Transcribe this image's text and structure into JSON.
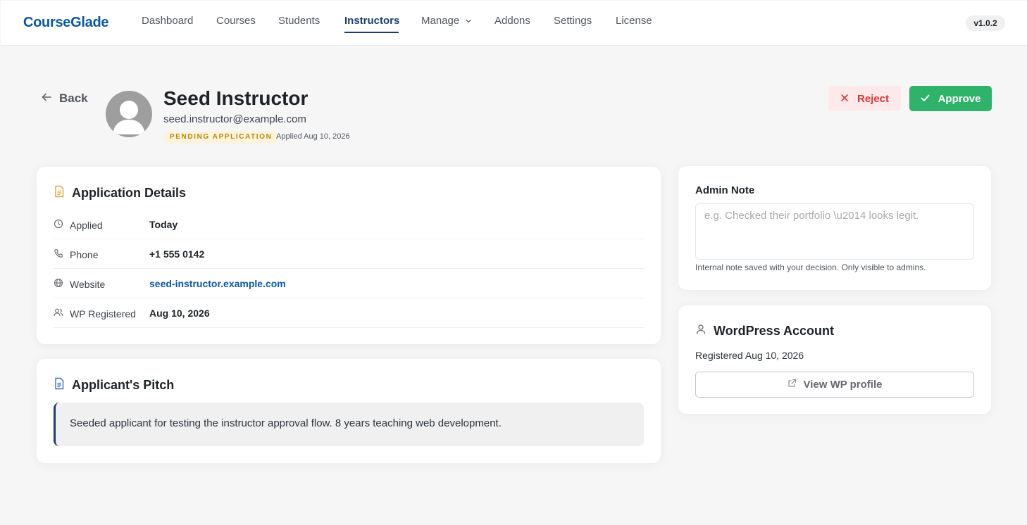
{
  "app": {
    "logo": "CourseGlade",
    "version": "v1.0.2"
  },
  "nav": {
    "items": [
      {
        "label": "Dashboard"
      },
      {
        "label": "Courses"
      },
      {
        "label": "Students"
      },
      {
        "label": "Instructors",
        "active": true
      },
      {
        "label": "Manage",
        "has_dropdown": true
      },
      {
        "label": "Addons"
      },
      {
        "label": "Settings"
      },
      {
        "label": "License"
      }
    ]
  },
  "header": {
    "back_label": "Back",
    "name": "Seed Instructor",
    "email": "seed.instructor@example.com",
    "status_badge": "PENDING APPLICATION",
    "applied_on": "Applied Aug 10, 2026",
    "reject_label": "Reject",
    "approve_label": "Approve"
  },
  "details": {
    "title": "Application Details",
    "rows": [
      {
        "label": "Applied",
        "value": "Today",
        "icon": "clock-icon"
      },
      {
        "label": "Phone",
        "value": "+1 555 0142",
        "icon": "phone-icon"
      },
      {
        "label": "Website",
        "value": "seed-instructor.example.com",
        "icon": "globe-icon",
        "link": true
      },
      {
        "label": "WP Registered",
        "value": "Aug 10, 2026",
        "icon": "users-icon"
      }
    ]
  },
  "pitch": {
    "title": "Applicant's Pitch",
    "text": "Seeded applicant for testing the instructor approval flow. 8 years teaching web development."
  },
  "admin_note": {
    "label": "Admin Note",
    "placeholder": "e.g. Checked their portfolio \\u2014 looks legit.",
    "value": "",
    "help": "Internal note saved with your decision. Only visible to admins."
  },
  "wp_account": {
    "title": "WordPress Account",
    "registered": "Registered Aug 10, 2026",
    "button_label": "View WP profile"
  },
  "colors": {
    "brand": "#0b57a4",
    "nav_active": "#1b3d6e",
    "approve": "#2fb36b",
    "reject_bg": "#fde9e9",
    "reject_text": "#d63638",
    "badge_bg": "#fcf3dd",
    "badge_text": "#b8860b"
  }
}
